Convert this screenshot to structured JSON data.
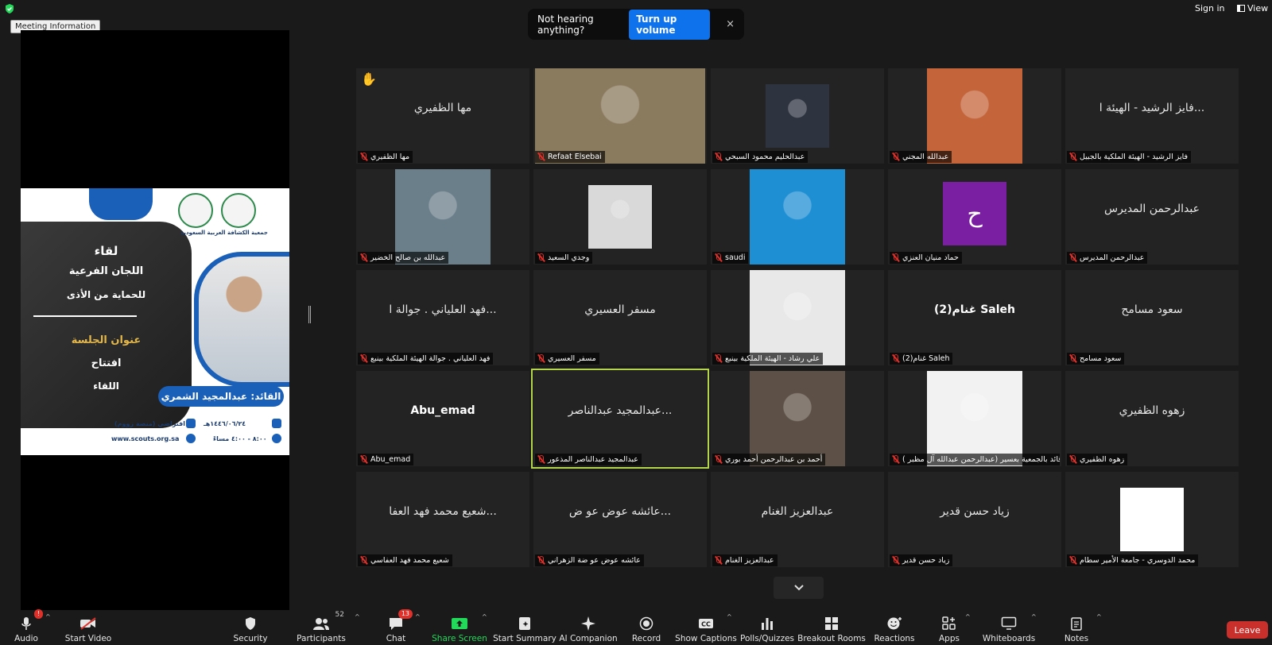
{
  "top": {
    "meeting_info": "Meeting Information",
    "banner_text": "Not hearing anything?",
    "banner_button": "Turn up volume",
    "banner_close": "×",
    "sign_in": "Sign in",
    "view": "View"
  },
  "share": {
    "org_name": "جمعية الكشافة العربية السعودية",
    "meeting_word": "لقاء",
    "committees": "اللجان الفرعية",
    "protection": "للحماية من الأذى",
    "session_title_label": "عنوان الجلسة",
    "opening": "افتتاح",
    "meeting": "اللقاء",
    "leader": "القائد: عبدالمجيد الشمري",
    "date": "١٤٤٦/٠٦/٢٤هـ",
    "platform": "افتراضي (منصة زووم)",
    "time": "٨:٠٠ - ٤:٠٠ مساءً",
    "website": "www.scouts.org.sa"
  },
  "tiles": [
    {
      "display": "مها الظفيري",
      "label": "مها الظفيري",
      "hand": "✋",
      "type": "name"
    },
    {
      "display": "",
      "label": "Refaat Elsebai",
      "type": "photo",
      "bg": "#8a7a5e"
    },
    {
      "display": "",
      "label": "عبدالحليم محمود السبحي",
      "type": "photo-small",
      "bg": "#2e3340"
    },
    {
      "display": "",
      "label": "عبدالله المجني",
      "type": "photo",
      "bg": "#c4643a"
    },
    {
      "display": "فايز الرشيد - الهيئة ا...",
      "label": "فايز الرشيد - الهيئة الملكية بالجبيل",
      "type": "name"
    },
    {
      "display": "",
      "label": "عبدالله بن صالح الخضير",
      "type": "photo",
      "bg": "#6b7f8a"
    },
    {
      "display": "",
      "label": "وجدي السعيد",
      "type": "photo-small",
      "bg": "#d9d9d9"
    },
    {
      "display": "",
      "label": "saudi",
      "type": "photo",
      "bg": "#1f8fd4"
    },
    {
      "display": "ح",
      "label": "حماد منيان العنزي",
      "type": "avatar",
      "bg": "#7a1fa2"
    },
    {
      "display": "عبدالرحمن المديرس",
      "label": "عبدالرحمن المديرس",
      "type": "name"
    },
    {
      "display": "فهد العلياني . جوالة ا...",
      "label": "فهد العلياني . جوالة الهيئة الملكية بينبع",
      "type": "name"
    },
    {
      "display": "مسفر العسيري",
      "label": "مسفر العسيري",
      "type": "name"
    },
    {
      "display": "",
      "label": "علي رشاد - الهيئة الملكية بينبع",
      "type": "photo",
      "bg": "#e8e8e8"
    },
    {
      "display": "غنام(2) Saleh",
      "label": "غنام(2) Saleh",
      "type": "name-bold"
    },
    {
      "display": "سعود مسامح",
      "label": "سعود مسامح",
      "type": "name"
    },
    {
      "display": "Abu_emad",
      "label": "Abu_emad",
      "type": "name-bold"
    },
    {
      "display": "عبدالمجيد عبدالناصر...",
      "label": "عبدالمجيد عبدالناصر المذعور",
      "type": "name",
      "active": true
    },
    {
      "display": "",
      "label": "أحمد بن عبدالرحمن أحمد بوري",
      "type": "photo",
      "bg": "#5d5046"
    },
    {
      "display": "",
      "label": "( عبدالرحمن عبدالله آل مظبر) قائد بالجمعية بعسير",
      "type": "photo",
      "bg": "#f2f2f2"
    },
    {
      "display": "زهوه الظفيري",
      "label": "زهوه الظفيري",
      "type": "name"
    },
    {
      "display": "شعيع محمد فهد العفا...",
      "label": "شعيع محمد فهد العفاسي",
      "type": "name"
    },
    {
      "display": "عائشه عوض عو ض...",
      "label": "عائشه عوض عو ضة الزهراني",
      "type": "name"
    },
    {
      "display": "عبدالعزيز الغنام",
      "label": "عبدالعزيز الغنام",
      "type": "name"
    },
    {
      "display": "زياد حسن قدير",
      "label": "زياد حسن قدير",
      "type": "name"
    },
    {
      "display": "",
      "label": "محمد الدوسري - جامعة الأمير سطام",
      "type": "photo-small",
      "bg": "#ffffff"
    }
  ],
  "toolbar": {
    "audio": "Audio",
    "audio_badge": "!",
    "start_video": "Start Video",
    "security": "Security",
    "participants": "Participants",
    "participants_count": "52",
    "chat": "Chat",
    "chat_badge": "13",
    "share_screen": "Share Screen",
    "start_summary": "Start Summary",
    "ai_companion": "AI Companion",
    "record": "Record",
    "show_captions": "Show Captions",
    "polls": "Polls/Quizzes",
    "breakout": "Breakout Rooms",
    "reactions": "Reactions",
    "apps": "Apps",
    "whiteboards": "Whiteboards",
    "notes": "Notes",
    "leave": "Leave",
    "caret": "^"
  },
  "colors": {
    "accent_blue": "#0e72ed",
    "leave_red": "#c9302c",
    "share_green": "#23d959",
    "active_speaker": "#b5d64c"
  }
}
